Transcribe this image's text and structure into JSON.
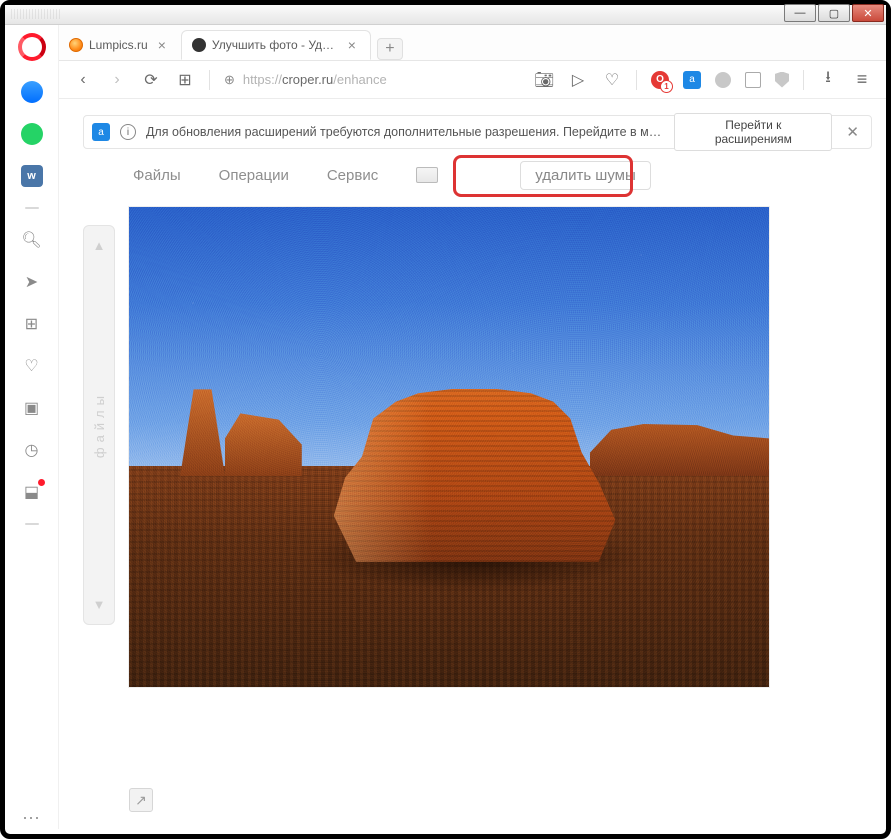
{
  "window": {
    "min": "—",
    "max": "▢",
    "close": "✕"
  },
  "tabs": [
    {
      "label": "Lumpics.ru",
      "active": false
    },
    {
      "label": "Улучшить фото - Удалени",
      "active": true
    }
  ],
  "newtab": "+",
  "nav": {
    "back": "‹",
    "forward": "›",
    "reload": "⟳",
    "speed_dial": "⊞",
    "url_scheme": "https://",
    "url_host": "croper.ru",
    "url_path": "/enhance",
    "icons": {
      "snapshot": "⌷",
      "send": "⟊",
      "heart": "♡",
      "opera_badge": "O",
      "translate": "a",
      "profile": "●",
      "wallet": "◧",
      "shield": "",
      "download": "⭳",
      "settings": "≡"
    }
  },
  "infobar": {
    "translate": "a",
    "info": "i",
    "text": "Для обновления расширений требуются дополнительные разрешения. Перейдите в ме...",
    "button": "Перейти к расширениям",
    "close": "✕"
  },
  "left_rail": {
    "items": [
      "messenger",
      "whatsapp",
      "vk",
      "dash",
      "search",
      "send",
      "apps",
      "heart",
      "news",
      "history",
      "cube",
      "dash",
      "dots"
    ]
  },
  "side_plus": "+",
  "app": {
    "menu": {
      "files": "Файлы",
      "operations": "Операции",
      "service": "Сервис"
    },
    "action_button": "удалить шумы",
    "side_tab_label": "файлы",
    "side_tab_up": "▲",
    "side_tab_down": "▼",
    "popout": "↗"
  }
}
